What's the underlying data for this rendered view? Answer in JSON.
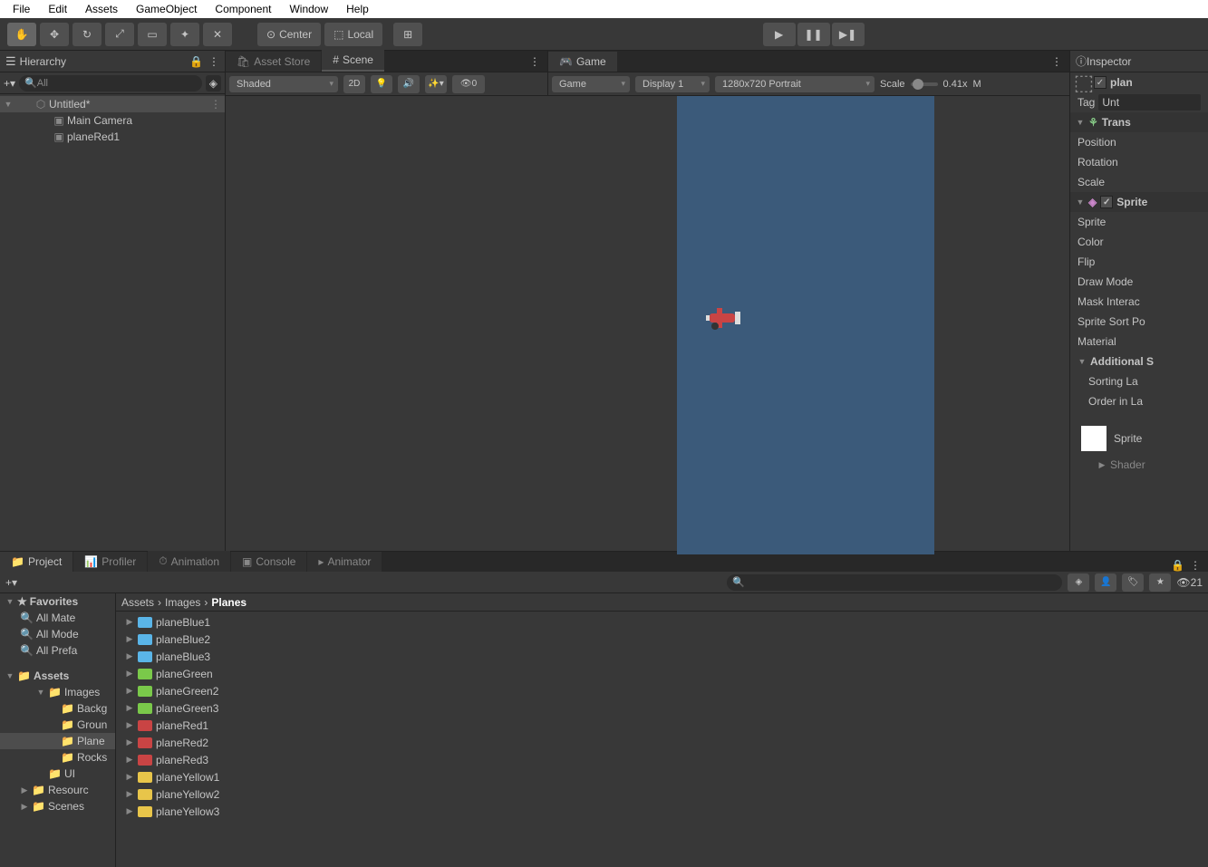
{
  "menu": [
    "File",
    "Edit",
    "Assets",
    "GameObject",
    "Component",
    "Window",
    "Help"
  ],
  "toolbar": {
    "center": "Center",
    "local": "Local"
  },
  "hierarchy": {
    "title": "Hierarchy",
    "search_placeholder": "All",
    "scene": "Untitled*",
    "items": [
      "Main Camera",
      "planeRed1"
    ]
  },
  "scene_tab": {
    "asset_store": "Asset Store",
    "scene": "Scene"
  },
  "scene_toolbar": {
    "shaded": "Shaded",
    "mode2d": "2D",
    "gizmo_count": "0"
  },
  "game_tab": {
    "game": "Game"
  },
  "game_toolbar": {
    "mode": "Game",
    "display": "Display 1",
    "res": "1280x720 Portrait",
    "scale_label": "Scale",
    "scale_val": "0.41x",
    "m": "M"
  },
  "inspector": {
    "title": "Inspector",
    "name": "plan",
    "tag_label": "Tag",
    "tag_val": "Unt",
    "transform": "Trans",
    "pos": "Position",
    "rot": "Rotation",
    "scale": "Scale",
    "sprite_renderer": "Sprite",
    "props": [
      "Sprite",
      "Color",
      "Flip",
      "Draw Mode",
      "Mask Interac",
      "Sprite Sort Po",
      "Material"
    ],
    "additional": "Additional S",
    "sorting_layer": "Sorting La",
    "order": "Order in La",
    "sprite_preview": "Sprite",
    "shader": "Shader"
  },
  "project": {
    "tabs": [
      "Project",
      "Profiler",
      "Animation",
      "Console",
      "Animator"
    ],
    "count": "21",
    "favorites": "Favorites",
    "fav_items": [
      "All Mate",
      "All Mode",
      "All Prefa"
    ],
    "assets": "Assets",
    "tree": [
      {
        "label": "Images",
        "lvl": 1,
        "exp": true
      },
      {
        "label": "Backg",
        "lvl": 2
      },
      {
        "label": "Groun",
        "lvl": 2
      },
      {
        "label": "Plane",
        "lvl": 2,
        "sel": true
      },
      {
        "label": "Rocks",
        "lvl": 2
      },
      {
        "label": "UI",
        "lvl": 1
      },
      {
        "label": "Resourc",
        "lvl": 0
      },
      {
        "label": "Scenes",
        "lvl": 0
      }
    ],
    "breadcrumb": [
      "Assets",
      "Images",
      "Planes"
    ],
    "assets_list": [
      {
        "name": "planeBlue1",
        "col": "blue"
      },
      {
        "name": "planeBlue2",
        "col": "blue"
      },
      {
        "name": "planeBlue3",
        "col": "blue"
      },
      {
        "name": "planeGreen",
        "col": "green"
      },
      {
        "name": "planeGreen2",
        "col": "green"
      },
      {
        "name": "planeGreen3",
        "col": "green"
      },
      {
        "name": "planeRed1",
        "col": "red"
      },
      {
        "name": "planeRed2",
        "col": "red"
      },
      {
        "name": "planeRed3",
        "col": "red"
      },
      {
        "name": "planeYellow1",
        "col": "yellow"
      },
      {
        "name": "planeYellow2",
        "col": "yellow"
      },
      {
        "name": "planeYellow3",
        "col": "yellow"
      }
    ]
  }
}
